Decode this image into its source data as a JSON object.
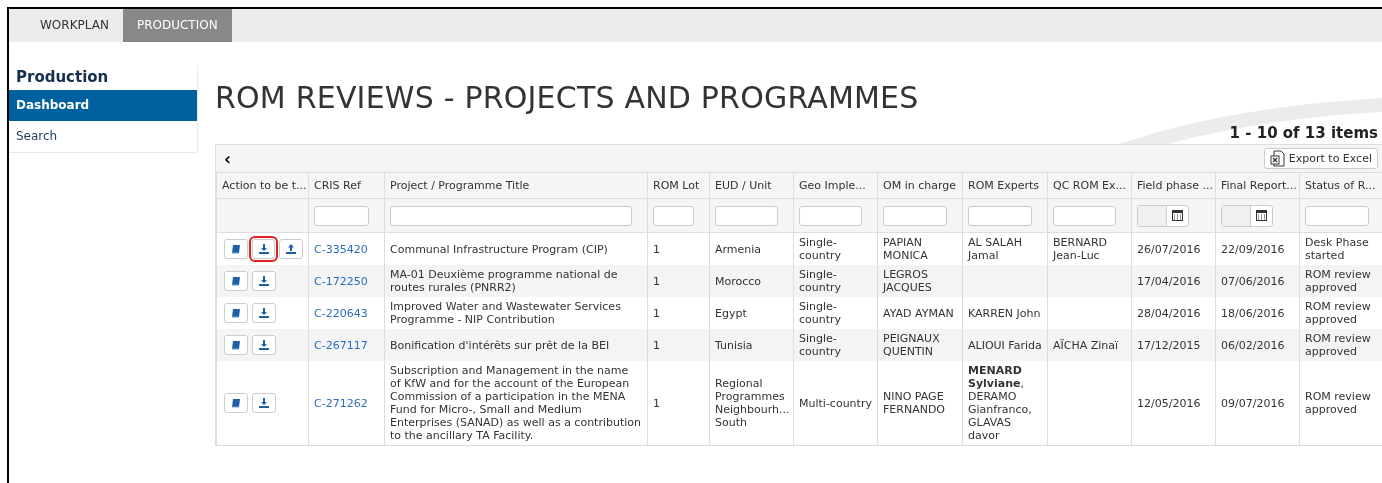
{
  "tabs": [
    {
      "label": "WORKPLAN",
      "selected": false
    },
    {
      "label": "PRODUCTION",
      "selected": true
    }
  ],
  "sidebar": {
    "heading": "Production",
    "items": [
      {
        "label": "Dashboard",
        "selected": true
      },
      {
        "label": "Search",
        "selected": false
      }
    ]
  },
  "page_title": "ROM REVIEWS - PROJECTS AND PROGRAMMES",
  "pager_summary": "1 - 10 of 13 items",
  "toolbar": {
    "back_icon": "‹",
    "export_button": "Export to Excel"
  },
  "table": {
    "columns": [
      {
        "label": "Action to be t...",
        "kind": "plain"
      },
      {
        "label": "CRIS Ref",
        "kind": "text"
      },
      {
        "label": "Project / Programme Title",
        "kind": "text"
      },
      {
        "label": "ROM Lot",
        "kind": "text"
      },
      {
        "label": "EUD / Unit",
        "kind": "text"
      },
      {
        "label": "Geo Imple...",
        "kind": "text"
      },
      {
        "label": "OM in charge",
        "kind": "text"
      },
      {
        "label": "ROM Experts",
        "kind": "text"
      },
      {
        "label": "QC ROM Ex...",
        "kind": "text"
      },
      {
        "label": "Field phase ...",
        "kind": "date"
      },
      {
        "label": "Final Report...",
        "kind": "date"
      },
      {
        "label": "Status of R...",
        "kind": "text"
      }
    ],
    "rows": [
      {
        "actions": [
          {
            "kind": "book",
            "highlighted": false
          },
          {
            "kind": "download",
            "highlighted": true
          },
          {
            "kind": "upload",
            "highlighted": false
          }
        ],
        "cris_ref": "C-335420",
        "title": "Communal Infrastructure Program (CIP)",
        "rom_lot": "1",
        "eud_unit": "Armenia",
        "geo": "Single-country",
        "om": "PAPIAN MONICA",
        "experts": "AL SALAH Jamal",
        "qc": "BERNARD Jean-Luc",
        "field_phase": "26/07/2016",
        "final_report": "22/09/2016",
        "status": "Desk Phase started"
      },
      {
        "actions": [
          {
            "kind": "book",
            "highlighted": false
          },
          {
            "kind": "download",
            "highlighted": false
          }
        ],
        "cris_ref": "C-172250",
        "title": "MA-01 Deuxième programme national de routes rurales (PNRR2)",
        "rom_lot": "1",
        "eud_unit": "Morocco",
        "geo": "Single-country",
        "om": "LEGROS JACQUES",
        "experts": "",
        "qc": "",
        "field_phase": "17/04/2016",
        "final_report": "07/06/2016",
        "status": "ROM review approved"
      },
      {
        "actions": [
          {
            "kind": "book",
            "highlighted": false
          },
          {
            "kind": "download",
            "highlighted": false
          }
        ],
        "cris_ref": "C-220643",
        "title": "Improved Water and Wastewater Services Programme - NIP Contribution",
        "rom_lot": "1",
        "eud_unit": "Egypt",
        "geo": "Single-country",
        "om": "AYAD AYMAN",
        "experts": "KARREN John",
        "qc": "",
        "field_phase": "28/04/2016",
        "final_report": "18/06/2016",
        "status": "ROM review approved"
      },
      {
        "actions": [
          {
            "kind": "book",
            "highlighted": false
          },
          {
            "kind": "download",
            "highlighted": false
          }
        ],
        "cris_ref": "C-267117",
        "title": "Bonification d'intérêts sur prêt de la BEI",
        "rom_lot": "1",
        "eud_unit": "Tunisia",
        "geo": "Single-country",
        "om": "PEIGNAUX QUENTIN",
        "experts": "ALIOUI Farida",
        "qc": "AÏCHA Zinaï",
        "field_phase": "17/12/2015",
        "final_report": "06/02/2016",
        "status": "ROM review approved"
      },
      {
        "actions": [
          {
            "kind": "book",
            "highlighted": false
          },
          {
            "kind": "download",
            "highlighted": false
          }
        ],
        "cris_ref": "C-271262",
        "title": "Subscription and Management in the name of KfW and for the account of the European Commission of a participation in the MENA Fund for Micro-, Small and Medium Enterprises (SANAD) as well as a contribution to the ancillary TA Facility.",
        "rom_lot": "1",
        "eud_unit": "Regional Programmes Neighbourh... South",
        "geo": "Multi-country",
        "om": "NINO PAGE FERNANDO",
        "experts": "**MENARD Sylviane**, DERAMO Gianfranco, GLAVAS davor",
        "qc": "",
        "field_phase": "12/05/2016",
        "final_report": "09/07/2016",
        "status": "ROM review approved"
      }
    ]
  }
}
